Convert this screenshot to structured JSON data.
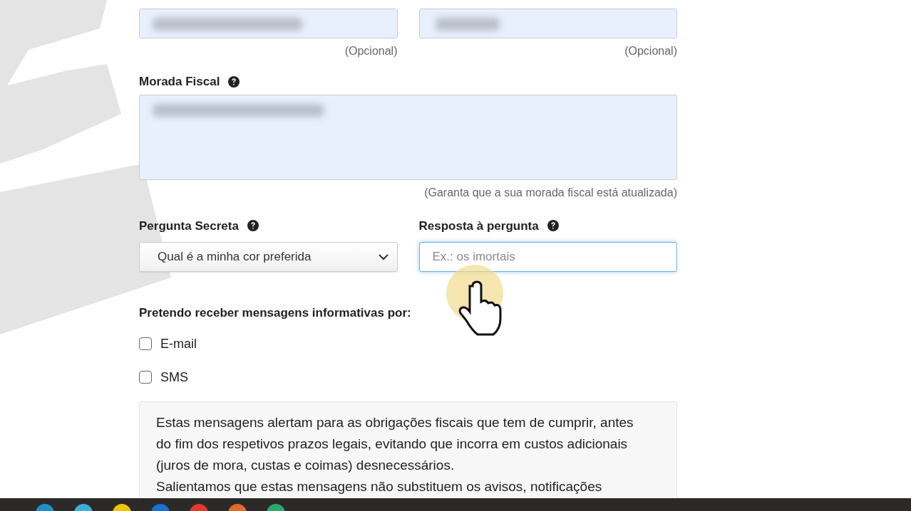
{
  "contact_fields": [
    {
      "hint": "(Opcional)"
    },
    {
      "hint": "(Opcional)"
    }
  ],
  "address": {
    "label": "Morada Fiscal",
    "hint": "(Garanta que a sua morada fiscal está atualizada)"
  },
  "secret_question": {
    "label": "Pergunta Secreta",
    "value": "Qual é a minha cor preferida"
  },
  "secret_answer": {
    "label": "Resposta à pergunta",
    "placeholder": "Ex.: os imortais",
    "focused": true
  },
  "notifications": {
    "label": "Pretendo receber mensagens informativas por:",
    "options": [
      {
        "label": "E-mail",
        "checked": false
      },
      {
        "label": "SMS",
        "checked": false
      }
    ]
  },
  "note": [
    "Estas mensagens alertam para as obrigações fiscais que tem de cumprir, antes do fim dos respetivos prazos legais, evitando que incorra em custos adicionais (juros de mora, custas e coimas) desnecessários.",
    "Salientamos que estas mensagens não substituem os avisos, notificações"
  ]
}
